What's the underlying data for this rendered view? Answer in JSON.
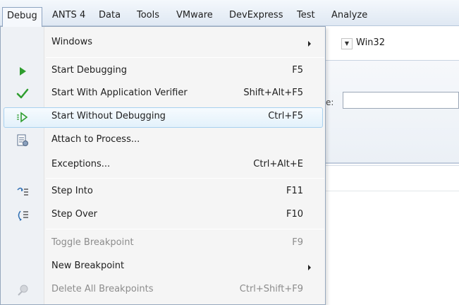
{
  "menubar": {
    "items": [
      {
        "label": "Debug",
        "active": true
      },
      {
        "label": "ANTS 4"
      },
      {
        "label": "Data"
      },
      {
        "label": "Tools"
      },
      {
        "label": "VMware"
      },
      {
        "label": "DevExpress"
      },
      {
        "label": "Test"
      },
      {
        "label": "Analyze"
      }
    ]
  },
  "background": {
    "platform_combo_value": "Win32",
    "field_label_fragment": "e:"
  },
  "debug_menu": {
    "items": [
      {
        "label": "Windows",
        "shortcut": "",
        "submenu": true,
        "icon": ""
      },
      {
        "label": "Start Debugging",
        "shortcut": "F5",
        "icon": "play-icon"
      },
      {
        "label": "Start With Application Verifier",
        "shortcut": "Shift+Alt+F5",
        "icon": "checkmark-icon"
      },
      {
        "label": "Start Without Debugging",
        "shortcut": "Ctrl+F5",
        "icon": "play-outline-icon",
        "highlighted": true
      },
      {
        "label": "Attach to Process...",
        "shortcut": "",
        "icon": "attach-process-icon"
      },
      {
        "label": "Exceptions...",
        "shortcut": "Ctrl+Alt+E",
        "icon": ""
      },
      {
        "label": "Step Into",
        "shortcut": "F11",
        "icon": "step-into-icon"
      },
      {
        "label": "Step Over",
        "shortcut": "F10",
        "icon": "step-over-icon"
      },
      {
        "label": "Toggle Breakpoint",
        "shortcut": "F9",
        "icon": "",
        "disabled": true
      },
      {
        "label": "New Breakpoint",
        "shortcut": "",
        "submenu": true,
        "icon": ""
      },
      {
        "label": "Delete All Breakpoints",
        "shortcut": "Ctrl+Shift+F9",
        "icon": "delete-breakpoints-icon",
        "disabled": true
      }
    ]
  },
  "colors": {
    "highlight_border": "#a8d1ef",
    "menu_border": "#97a8bd",
    "play_green": "#2e9d2e",
    "disabled_text": "#8c8c8c"
  }
}
